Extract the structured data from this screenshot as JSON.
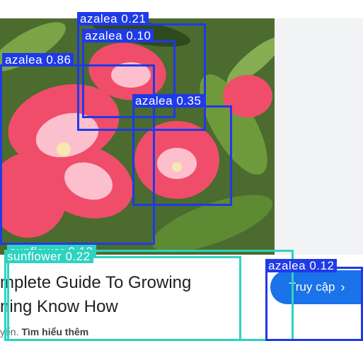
{
  "ad": {
    "title_line1": "mplete Guide To Growing",
    "title_line2": "ning Know How",
    "footer_prefix": "yến.",
    "footer_link": "Tìm hiểu thêm",
    "cta_label": "Truy cập",
    "cta_chevron": "chevron-right-icon"
  },
  "detections": [
    {
      "label": "azalea 0.21"
    },
    {
      "label": "azalea 0.10"
    },
    {
      "label": "azalea 0.86"
    },
    {
      "label": "azalea 0.35"
    },
    {
      "label": "sunflower 0.13"
    },
    {
      "label": "sunflower 0.22"
    },
    {
      "label": "azalea 0.12"
    }
  ],
  "colors": {
    "box_blue": "#1f3ae8",
    "box_teal": "#2ed3c0",
    "cta_blue": "#1a73e8"
  }
}
